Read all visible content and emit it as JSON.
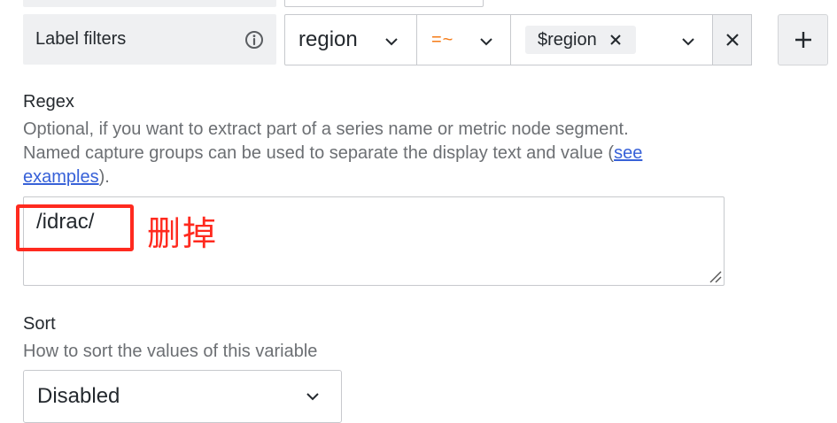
{
  "label_filters": {
    "label": "Label filters",
    "key": "region",
    "operator": "=~",
    "value_chip": "$region"
  },
  "regex": {
    "title": "Regex",
    "description_line1": "Optional, if you want to extract part of a series name or metric node segment.",
    "description_line2_before_link": "Named capture groups can be used to separate the display text and value (",
    "link_part1": "see",
    "link_part2": "examples",
    "description_after_link": ").",
    "value": "/idrac/"
  },
  "annotation": {
    "text": "删掉",
    "color": "#ff2a1f"
  },
  "sort": {
    "title": "Sort",
    "description": "How to sort the values of this variable",
    "selected": "Disabled"
  },
  "colors": {
    "operator": "#f57b17",
    "link": "#3761d8",
    "panel_gray": "#eff0f2"
  },
  "icons": [
    "info-icon",
    "chevron-down-icon",
    "close-icon",
    "plus-icon",
    "resize-handle-icon"
  ]
}
